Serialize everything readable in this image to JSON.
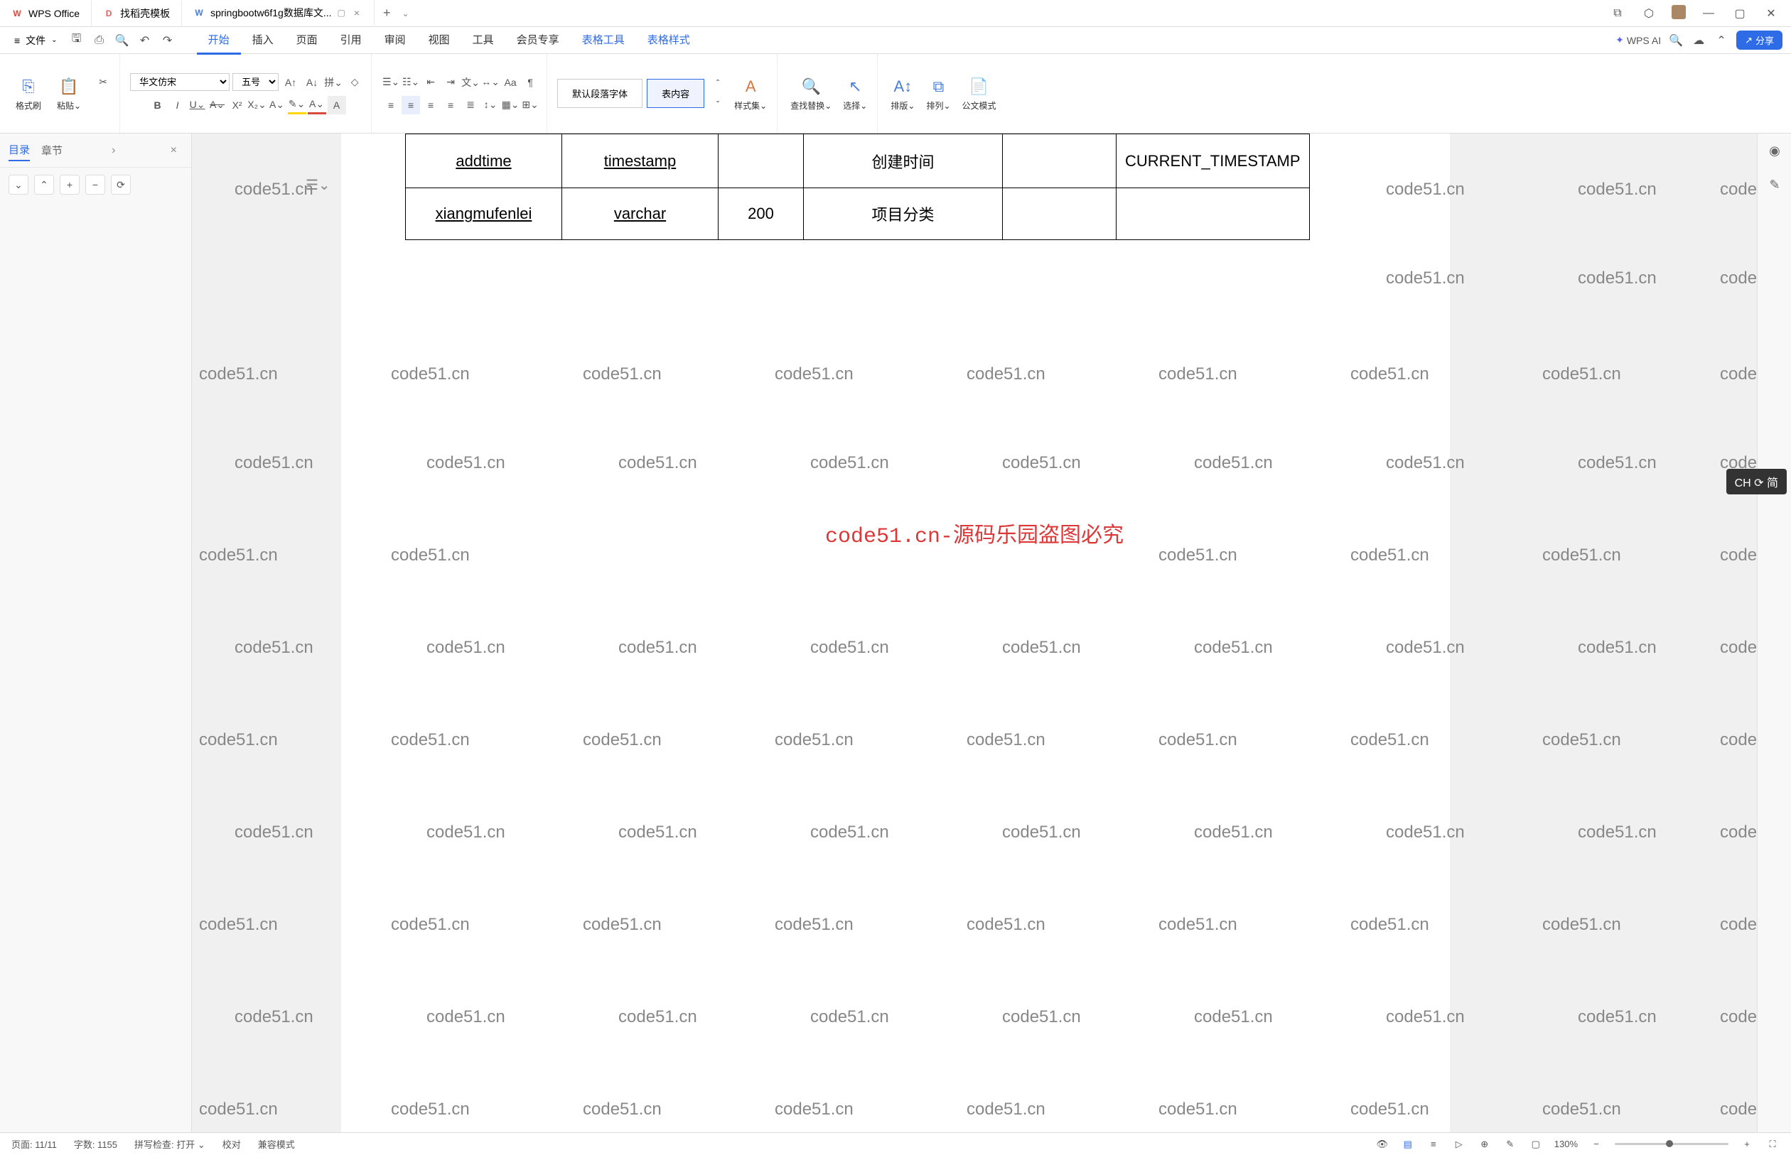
{
  "titlebar": {
    "tabs": [
      {
        "icon": "W",
        "label": "WPS Office"
      },
      {
        "icon": "D",
        "label": "找稻壳模板"
      },
      {
        "icon": "W",
        "label": "springbootw6f1g数据库文..."
      }
    ],
    "add": "+"
  },
  "menubar": {
    "file": "文件",
    "items": [
      "开始",
      "插入",
      "页面",
      "引用",
      "审阅",
      "视图",
      "工具",
      "会员专享",
      "表格工具",
      "表格样式"
    ],
    "active_index": 0,
    "wps_ai": "WPS AI",
    "share": "分享"
  },
  "ribbon": {
    "format_painter": "格式刷",
    "paste": "粘贴",
    "font_name": "华文仿宋",
    "font_size": "五号",
    "para_style_default": "默认段落字体",
    "para_style_table": "表内容",
    "style_set": "样式集",
    "find_replace": "查找替换",
    "select": "选择",
    "arrange": "排版",
    "sort": "排列",
    "doc_mode": "公文模式"
  },
  "sidebar": {
    "toc": "目录",
    "chapter": "章节"
  },
  "table": {
    "rows": [
      {
        "c1": "addtime",
        "c2": "timestamp",
        "c3": "",
        "c4": "创建时间",
        "c5": "",
        "c6": "CURRENT_TIMESTAMP"
      },
      {
        "c1": "xiangmufenlei",
        "c2": "varchar",
        "c3": "200",
        "c4": "项目分类",
        "c5": "",
        "c6": ""
      }
    ]
  },
  "center_text": "code51.cn-源码乐园盗图必究",
  "watermark": "code51.cn",
  "statusbar": {
    "page": "页面: 11/11",
    "words": "字数: 1155",
    "spell": "拼写检查: 打开",
    "proof": "校对",
    "compat": "兼容模式",
    "zoom": "130%"
  },
  "ime": "CH ⟳ 简"
}
